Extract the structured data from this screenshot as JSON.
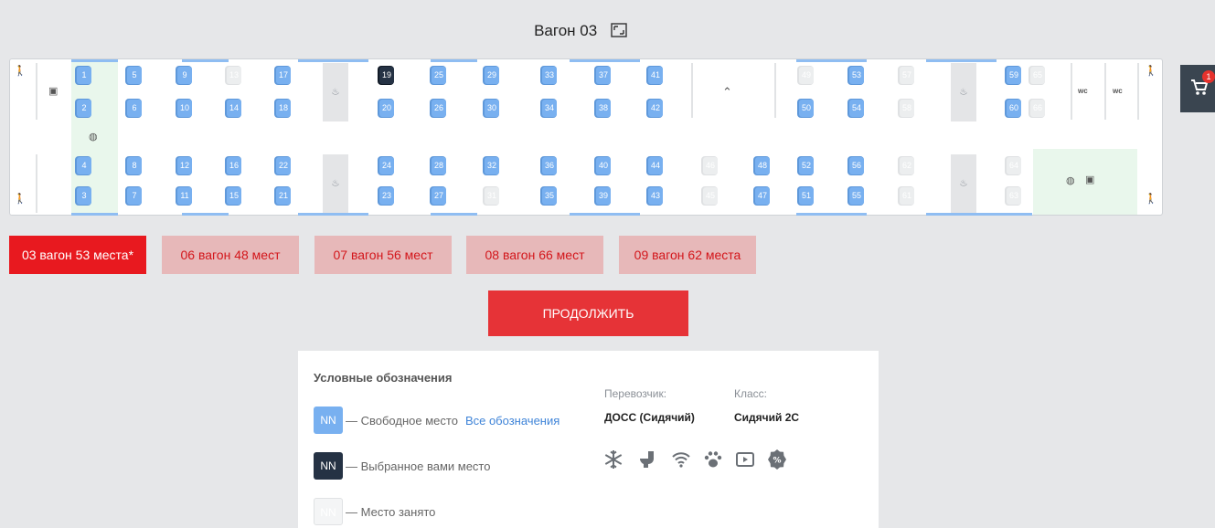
{
  "wagon": {
    "title": "Вагон 03"
  },
  "seats": {
    "free": [
      "1",
      "2",
      "3",
      "4",
      "5",
      "6",
      "7",
      "8",
      "9",
      "10",
      "11",
      "12",
      "14",
      "15",
      "16",
      "17",
      "18",
      "20",
      "21",
      "22",
      "23",
      "24",
      "25",
      "26",
      "27",
      "28",
      "29",
      "30",
      "32",
      "33",
      "34",
      "35",
      "36",
      "37",
      "38",
      "39",
      "40",
      "41",
      "42",
      "43",
      "44",
      "47",
      "48",
      "50",
      "51",
      "52",
      "53",
      "54",
      "55",
      "56",
      "59",
      "60"
    ],
    "selected": [
      "19"
    ],
    "occupied": [
      "13",
      "31",
      "45",
      "46",
      "49",
      "57",
      "58",
      "61",
      "62",
      "63",
      "64",
      "65",
      "66"
    ]
  },
  "facilities": {
    "wc_label": "wc"
  },
  "cart": {
    "count": "1"
  },
  "wagon_tabs": [
    {
      "label": "03 вагон 53 места*",
      "active": true
    },
    {
      "label": "06 вагон 48 мест",
      "active": false
    },
    {
      "label": "07 вагон 56 мест",
      "active": false
    },
    {
      "label": "08 вагон 66 мест",
      "active": false
    },
    {
      "label": "09 вагон 62 места",
      "active": false
    }
  ],
  "actions": {
    "continue_label": "ПРОДОЛЖИТЬ"
  },
  "legend": {
    "title": "Условные обозначения",
    "seat_sample": "NN",
    "free_label": "— Свободное место",
    "all_link": "Все обозначения",
    "selected_label": "— Выбранное вами место",
    "occupied_label": "— Место занято",
    "carrier_label": "Перевозчик:",
    "carrier_value": "ДОСС (Сидячий)",
    "class_label": "Класс:",
    "class_value": "Сидячий 2С",
    "amenities": [
      "snowflake-icon",
      "toilet-icon",
      "wifi-icon",
      "paw-icon",
      "video-icon",
      "discount-icon"
    ]
  },
  "colors": {
    "free": "#78b0f0",
    "selected": "#253244",
    "occupied": "#eceeef",
    "accent": "#e8191f"
  }
}
